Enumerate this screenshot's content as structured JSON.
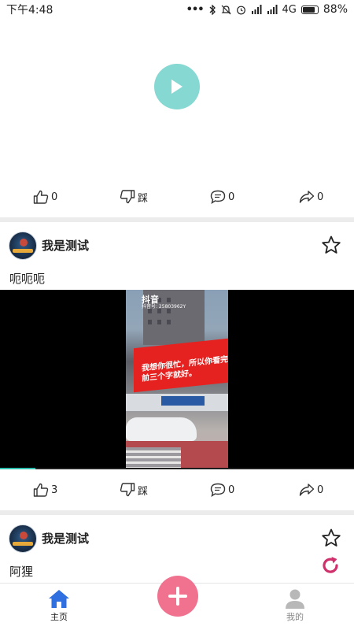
{
  "status_bar": {
    "time": "下午4:48",
    "network": "4G",
    "battery_percent": "88%",
    "battery_level": 0.88
  },
  "top_post": {
    "play_icon": "play-icon",
    "actions": {
      "like_count": "0",
      "dislike_label": "踩",
      "comment_count": "0",
      "share_count": "0"
    }
  },
  "post_1": {
    "username": "我是测试",
    "text": "呃呃呃",
    "video": {
      "watermark": "抖音",
      "watermark_id": "抖音号: 25803962Y",
      "billboard_text": "我想你很忙，所以你看完前三个字就好。",
      "progress": 0.1
    },
    "actions": {
      "like_count": "3",
      "dislike_label": "踩",
      "comment_count": "0",
      "share_count": "0"
    }
  },
  "post_2": {
    "username": "我是测试",
    "text": "阿狸"
  },
  "tab_bar": {
    "home_label": "主页",
    "mine_label": "我的",
    "active_color": "#2f6fe0",
    "inactive_color": "#b8b8b8",
    "fab_color": "#f0728f"
  },
  "colors": {
    "play_button": "#86d8d2",
    "reload_icon": "#d0306c",
    "progress": "#2cbfae"
  }
}
